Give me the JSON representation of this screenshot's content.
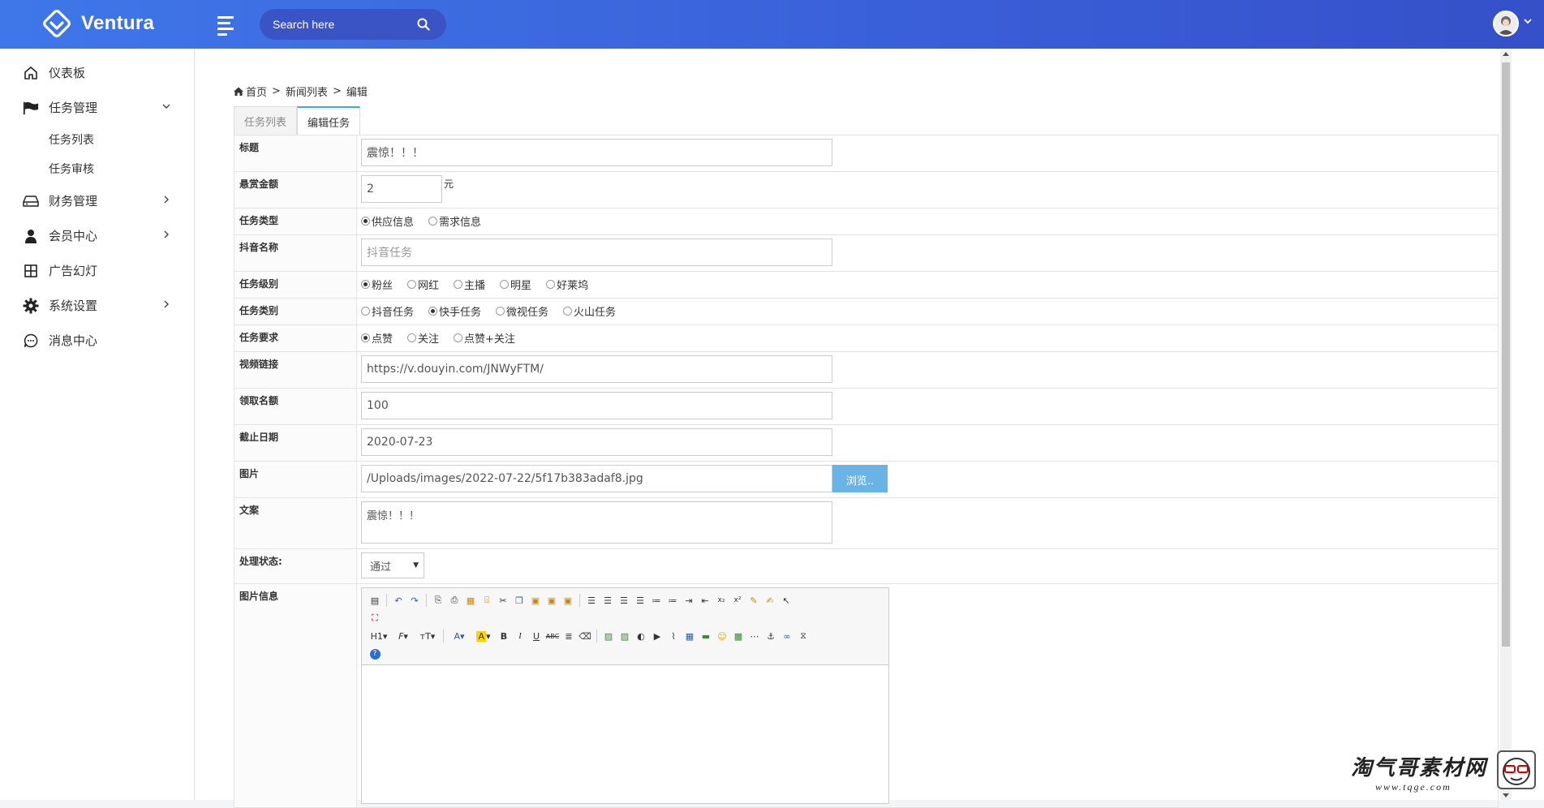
{
  "app": {
    "name": "Ventura"
  },
  "search": {
    "placeholder": "Search here"
  },
  "sidebar": {
    "items": [
      {
        "label": "仪表板",
        "icon": "home-icon"
      },
      {
        "label": "任务管理",
        "icon": "flag-icon",
        "expanded": true,
        "children": [
          {
            "label": "任务列表"
          },
          {
            "label": "任务审核"
          }
        ]
      },
      {
        "label": "财务管理",
        "icon": "drive-icon"
      },
      {
        "label": "会员中心",
        "icon": "user-icon"
      },
      {
        "label": "广告幻灯",
        "icon": "grid-icon"
      },
      {
        "label": "系统设置",
        "icon": "gear-icon"
      },
      {
        "label": "消息中心",
        "icon": "chat-icon"
      }
    ]
  },
  "breadcrumb": {
    "home": "首页",
    "sep": ">",
    "list": "新闻列表",
    "current": "编辑"
  },
  "tabs": [
    {
      "label": "任务列表"
    },
    {
      "label": "编辑任务",
      "active": true
    }
  ],
  "form": {
    "title": {
      "label": "标题",
      "value": "震惊！！！"
    },
    "reward": {
      "label": "悬赏金额",
      "value": "2",
      "unit": "元"
    },
    "type": {
      "label": "任务类型",
      "options": [
        "供应信息",
        "需求信息"
      ],
      "selected": "供应信息"
    },
    "douyin_name": {
      "label": "抖音名称",
      "placeholder": "抖音任务"
    },
    "level": {
      "label": "任务级别",
      "options": [
        "粉丝",
        "网红",
        "主播",
        "明星",
        "好莱坞"
      ],
      "selected": "粉丝"
    },
    "category": {
      "label": "任务类别",
      "options": [
        "抖音任务",
        "快手任务",
        "微视任务",
        "火山任务"
      ],
      "selected": "快手任务"
    },
    "requirement": {
      "label": "任务要求",
      "options": [
        "点赞",
        "关注",
        "点赞+关注"
      ],
      "selected": "点赞"
    },
    "video_link": {
      "label": "视频链接",
      "value": "https://v.douyin.com/JNWyFTM/"
    },
    "quota": {
      "label": "领取名额",
      "value": "100"
    },
    "deadline": {
      "label": "截止日期",
      "value": "2020-07-23"
    },
    "image": {
      "label": "图片",
      "value": "/Uploads/images/2022-07-22/5f17b383adaf8.jpg",
      "browse": "浏览.."
    },
    "copy": {
      "label": "文案",
      "value": "震惊！！！"
    },
    "status": {
      "label": "处理状态:",
      "value": "通过"
    },
    "image_info": {
      "label": "图片信息"
    }
  },
  "editor": {
    "heading": "H1",
    "font": "F",
    "size": "тT",
    "bold": "B",
    "italic": "I",
    "underline": "U",
    "strike": "ABC"
  },
  "watermark": {
    "line1": "淘气哥素材网",
    "line2": "www.tqge.com"
  }
}
